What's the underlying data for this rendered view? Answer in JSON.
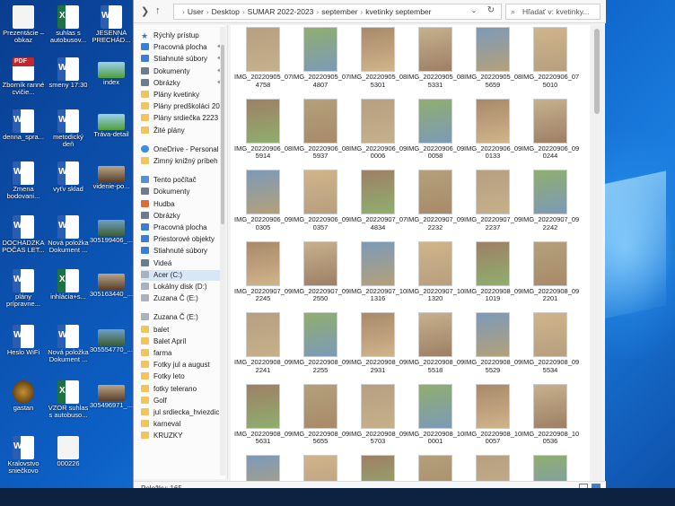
{
  "desktop": {
    "icons": [
      {
        "label": "Prezentácie – obkaz",
        "kind": "app"
      },
      {
        "label": "suhlas s autobusov...",
        "kind": "excel"
      },
      {
        "label": "JESENNÁ PRECHÁD...",
        "kind": "word"
      },
      {
        "label": "Zborník ranné cvičie...",
        "kind": "pdf"
      },
      {
        "label": "smeny 17:30",
        "kind": "word"
      },
      {
        "label": "index",
        "kind": "green"
      },
      {
        "label": "denna_spra...",
        "kind": "word"
      },
      {
        "label": "metodický deň",
        "kind": "word"
      },
      {
        "label": "Tráva-detail",
        "kind": "green"
      },
      {
        "label": "Zmena bodovani...",
        "kind": "word"
      },
      {
        "label": "vyťv sklad",
        "kind": "word"
      },
      {
        "label": "videnie-po...",
        "kind": "photo2"
      },
      {
        "label": "DOCHÁDZKA POČAS LET...",
        "kind": "word"
      },
      {
        "label": "Nová položka Dokument ...",
        "kind": "word"
      },
      {
        "label": "305199406_...",
        "kind": "photo"
      },
      {
        "label": "plány prípravne...",
        "kind": "word"
      },
      {
        "label": "inhlácia+s...",
        "kind": "excel"
      },
      {
        "label": "305163440_...",
        "kind": "photo2"
      },
      {
        "label": "Heslo WiFi",
        "kind": "word"
      },
      {
        "label": "Nová položka Dokument ...",
        "kind": "word"
      },
      {
        "label": "305554770_...",
        "kind": "photo"
      },
      {
        "label": "gastan",
        "kind": "brown"
      },
      {
        "label": "VZOR suhlas s autobuso...",
        "kind": "excel"
      },
      {
        "label": "305496971_...",
        "kind": "photo2"
      },
      {
        "label": "Kralovstvo sniečkovo",
        "kind": "word"
      },
      {
        "label": "000226",
        "kind": "app"
      }
    ]
  },
  "explorer": {
    "breadcrumb": [
      "User",
      "Desktop",
      "SUMAR 2022-2023",
      "september",
      "kvetinky september"
    ],
    "search_placeholder": "Hľadať v: kvetinky...",
    "status_text": "Položky: 165",
    "nav": [
      {
        "label": "Rýchly prístup",
        "icon": "star"
      },
      {
        "label": "Pracovná plocha",
        "icon": "blue",
        "pinned": true
      },
      {
        "label": "Stiahnuté súbory",
        "icon": "blue",
        "pinned": true
      },
      {
        "label": "Dokumenty",
        "icon": "gray",
        "pinned": true
      },
      {
        "label": "Obrázky",
        "icon": "gray",
        "pinned": true
      },
      {
        "label": "Plány kvetinky",
        "icon": "folder"
      },
      {
        "label": "Plány predškoláci 20",
        "icon": "folder"
      },
      {
        "label": "Plány srdiečka 2223",
        "icon": "folder"
      },
      {
        "label": "Žité plány",
        "icon": "folder"
      },
      {
        "label": "OneDrive - Personal",
        "icon": "cloud"
      },
      {
        "label": "Zimný knižný príbeh",
        "icon": "folder"
      },
      {
        "label": "Tento počítač",
        "icon": "pc"
      },
      {
        "label": "Dokumenty",
        "icon": "gray"
      },
      {
        "label": "Hudba",
        "icon": "music"
      },
      {
        "label": "Obrázky",
        "icon": "gray"
      },
      {
        "label": "Pracovná plocha",
        "icon": "blue"
      },
      {
        "label": "Priestorové objekty",
        "icon": "blue"
      },
      {
        "label": "Stiahnuté súbory",
        "icon": "blue"
      },
      {
        "label": "Videá",
        "icon": "gray"
      },
      {
        "label": "Acer (C:)",
        "icon": "drive",
        "selected": true
      },
      {
        "label": "Lokálny disk (D:)",
        "icon": "drive"
      },
      {
        "label": "Zuzana Č (E:)",
        "icon": "drive"
      },
      {
        "label": "Zuzana Č (E:)",
        "icon": "drive"
      },
      {
        "label": "balet",
        "icon": "folder"
      },
      {
        "label": "Balet Apríl",
        "icon": "folder"
      },
      {
        "label": "farma",
        "icon": "folder"
      },
      {
        "label": "Fotky jul a august",
        "icon": "folder"
      },
      {
        "label": "Fotky leto",
        "icon": "folder"
      },
      {
        "label": "fotky telerano",
        "icon": "folder"
      },
      {
        "label": "Golf",
        "icon": "folder"
      },
      {
        "label": "jul srdiecka_hviezdic",
        "icon": "folder"
      },
      {
        "label": "karneval",
        "icon": "folder"
      },
      {
        "label": "KRUZKY",
        "icon": "folder"
      }
    ],
    "files": [
      {
        "l1": "IMG_20220905_07",
        "l2": "4758"
      },
      {
        "l1": "IMG_20220905_07",
        "l2": "4807"
      },
      {
        "l1": "IMG_20220905_08",
        "l2": "5301"
      },
      {
        "l1": "IMG_20220905_08",
        "l2": "5331"
      },
      {
        "l1": "IMG_20220905_08",
        "l2": "5659"
      },
      {
        "l1": "IMG_20220906_07",
        "l2": "5010"
      },
      {
        "l1": "IMG_20220906_08",
        "l2": "5914"
      },
      {
        "l1": "IMG_20220906_08",
        "l2": "5937"
      },
      {
        "l1": "IMG_20220906_09",
        "l2": "0006"
      },
      {
        "l1": "IMG_20220906_09",
        "l2": "0058"
      },
      {
        "l1": "IMG_20220906_09",
        "l2": "0133"
      },
      {
        "l1": "IMG_20220906_09",
        "l2": "0244"
      },
      {
        "l1": "IMG_20220906_09",
        "l2": "0305"
      },
      {
        "l1": "IMG_20220906_09",
        "l2": "0357"
      },
      {
        "l1": "IMG_20220907_07",
        "l2": "4834"
      },
      {
        "l1": "IMG_20220907_09",
        "l2": "2232"
      },
      {
        "l1": "IMG_20220907_09",
        "l2": "2237"
      },
      {
        "l1": "IMG_20220907_09",
        "l2": "2242"
      },
      {
        "l1": "IMG_20220907_09",
        "l2": "2245"
      },
      {
        "l1": "IMG_20220907_09",
        "l2": "2550"
      },
      {
        "l1": "IMG_20220907_10",
        "l2": "1316"
      },
      {
        "l1": "IMG_20220907_10",
        "l2": "1320"
      },
      {
        "l1": "IMG_20220908_09",
        "l2": "1019"
      },
      {
        "l1": "IMG_20220908_09",
        "l2": "2201"
      },
      {
        "l1": "IMG_20220908_09",
        "l2": "2241"
      },
      {
        "l1": "IMG_20220908_09",
        "l2": "2255"
      },
      {
        "l1": "IMG_20220908_09",
        "l2": "2931"
      },
      {
        "l1": "IMG_20220908_09",
        "l2": "5518"
      },
      {
        "l1": "IMG_20220908_09",
        "l2": "5529"
      },
      {
        "l1": "IMG_20220908_09",
        "l2": "5534"
      },
      {
        "l1": "IMG_20220908_09",
        "l2": "5631"
      },
      {
        "l1": "IMG_20220908_09",
        "l2": "5655"
      },
      {
        "l1": "IMG_20220908_09",
        "l2": "5703"
      },
      {
        "l1": "IMG_20220908_10",
        "l2": "0001"
      },
      {
        "l1": "IMG_20220908_10",
        "l2": "0057"
      },
      {
        "l1": "IMG_20220908_10",
        "l2": "0536"
      },
      {
        "l1": "",
        "l2": ""
      },
      {
        "l1": "",
        "l2": ""
      },
      {
        "l1": "",
        "l2": ""
      },
      {
        "l1": "",
        "l2": ""
      },
      {
        "l1": "",
        "l2": ""
      },
      {
        "l1": "",
        "l2": ""
      }
    ]
  },
  "colors": {
    "desktop_blue": "#0c5fc4",
    "selection": "#d9e6f5",
    "folder_yellow": "#f2c55c"
  }
}
